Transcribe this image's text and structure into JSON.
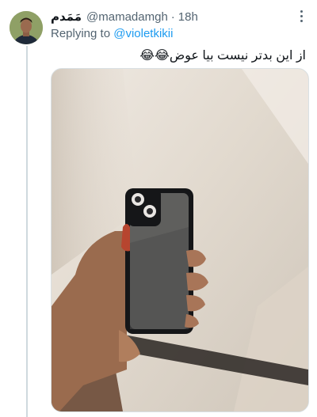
{
  "tweet": {
    "author_name": "مَمَدم",
    "author_handle": "@mamadamgh",
    "separator": "·",
    "timestamp": "18h",
    "replying_prefix": "Replying to",
    "replying_to": "@violetkikii",
    "text": "از این بدتر نیست بیا عوض😂😂"
  },
  "icons": {
    "more": "more-options-icon",
    "avatar": "avatar"
  },
  "colors": {
    "link": "#1d9bf0",
    "secondary_text": "#536471",
    "thread_line": "#cfd9de"
  }
}
